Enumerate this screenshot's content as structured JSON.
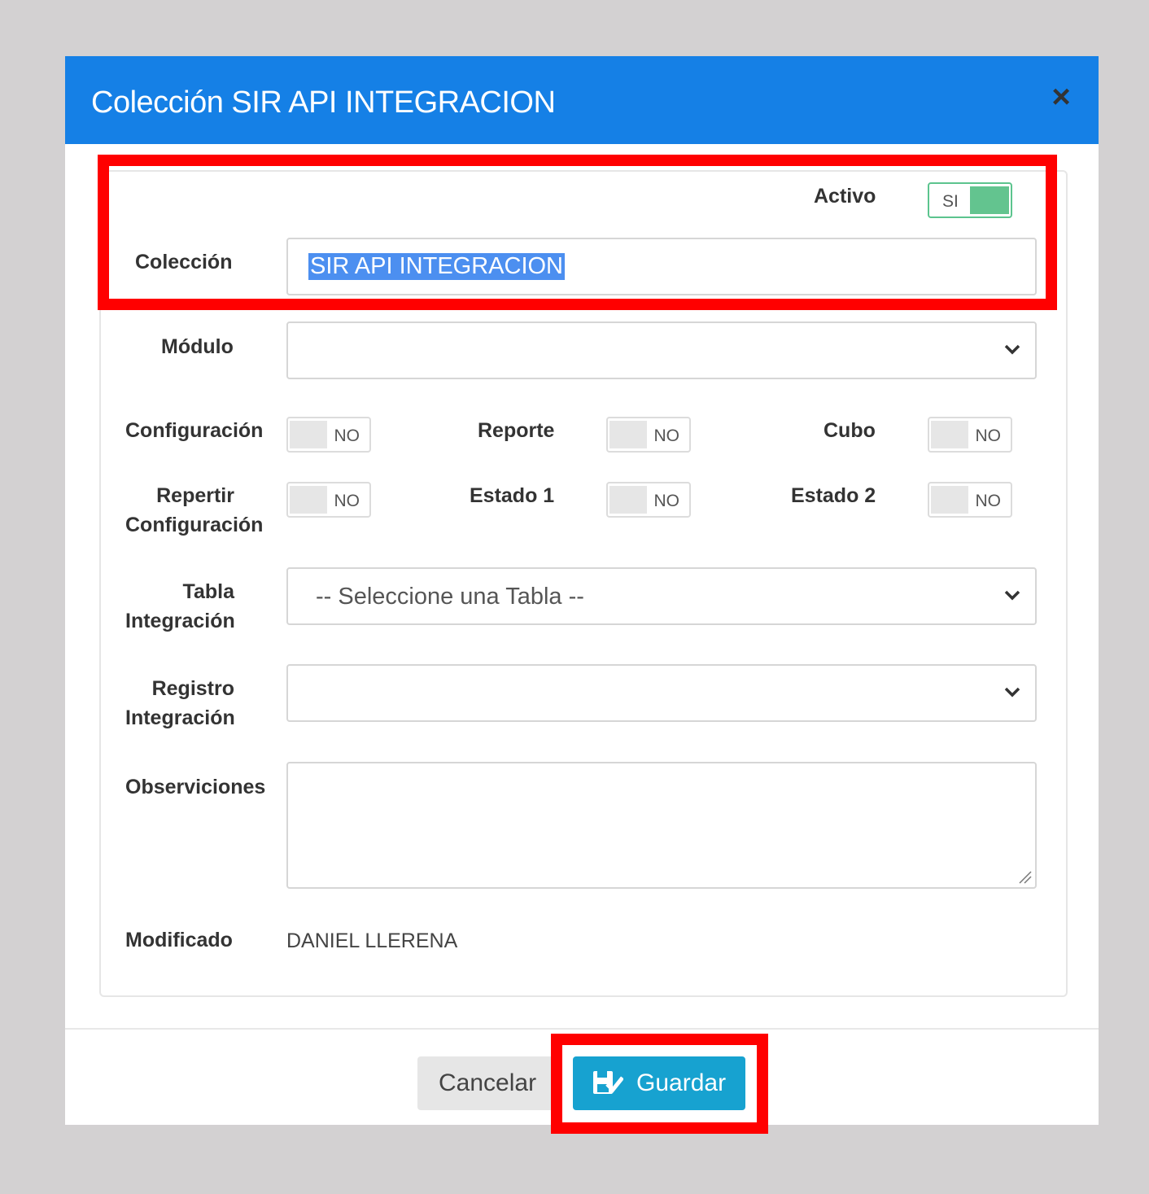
{
  "modal": {
    "title": "Colección SIR API INTEGRACION",
    "close_glyph": "×"
  },
  "form": {
    "activo": {
      "label": "Activo",
      "state": "SI",
      "on": true
    },
    "coleccion": {
      "label": "Colección",
      "value": "SIR API INTEGRACION"
    },
    "modulo": {
      "label": "Módulo",
      "value": ""
    },
    "configuracion": {
      "label": "Configuración",
      "state": "NO"
    },
    "reporte": {
      "label": "Reporte",
      "state": "NO"
    },
    "cubo": {
      "label": "Cubo",
      "state": "NO"
    },
    "repertir_configuracion": {
      "label_line1": "Repertir",
      "label_line2": "Configuración",
      "state": "NO"
    },
    "estado1": {
      "label": "Estado 1",
      "state": "NO"
    },
    "estado2": {
      "label": "Estado 2",
      "state": "NO"
    },
    "tabla_integracion": {
      "label_line1": "Tabla",
      "label_line2": "Integración",
      "value": "-- Seleccione una Tabla --"
    },
    "registro_integracion": {
      "label_line1": "Registro",
      "label_line2": "Integración",
      "value": ""
    },
    "observaciones": {
      "label": "Observiciones",
      "value": ""
    },
    "modificado": {
      "label": "Modificado",
      "value": "DANIEL LLERENA"
    }
  },
  "footer": {
    "cancel_label": "Cancelar",
    "save_label": "Guardar"
  },
  "colors": {
    "header": "#1580e6",
    "toggle_on": "#63c48f",
    "save_button": "#17a2d0",
    "highlight": "#ff0000"
  }
}
